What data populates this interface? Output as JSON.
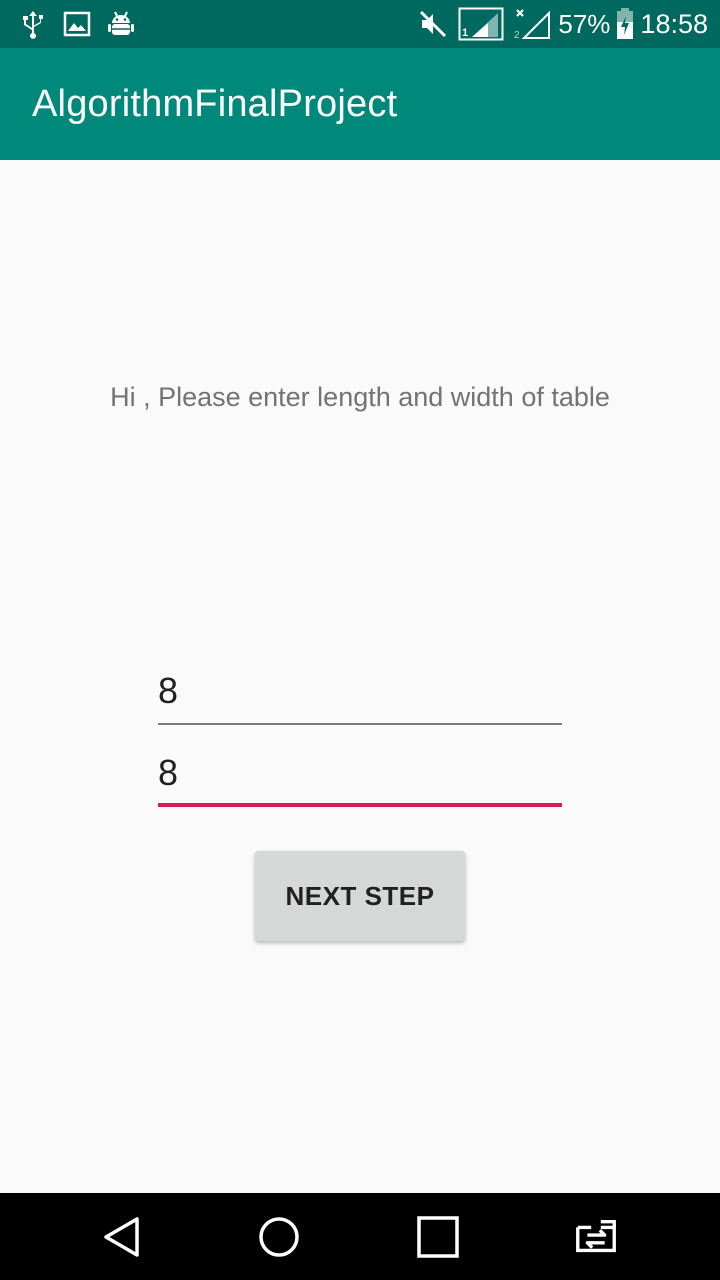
{
  "status_bar": {
    "icons_left": [
      "usb-icon",
      "image-icon",
      "android-debug-icon"
    ],
    "icons_right": [
      "mute-icon",
      "signal-sim1-icon",
      "signal-sim2-icon",
      "battery-charging-icon"
    ],
    "battery_percent": "57%",
    "time": "18:58"
  },
  "toolbar": {
    "title": "AlgorithmFinalProject"
  },
  "main": {
    "prompt": "Hi , Please enter length and width of table",
    "length_value": "8",
    "width_value": "8",
    "next_button_label": "NEXT STEP"
  },
  "nav_bar": {
    "buttons": [
      "back-icon",
      "home-icon",
      "recents-icon",
      "app-switch-icon"
    ]
  },
  "colors": {
    "status_bar": "#00695f",
    "toolbar": "#00897b",
    "accent": "#d81b60",
    "background": "#fafafa",
    "button": "#d6d7d7"
  }
}
